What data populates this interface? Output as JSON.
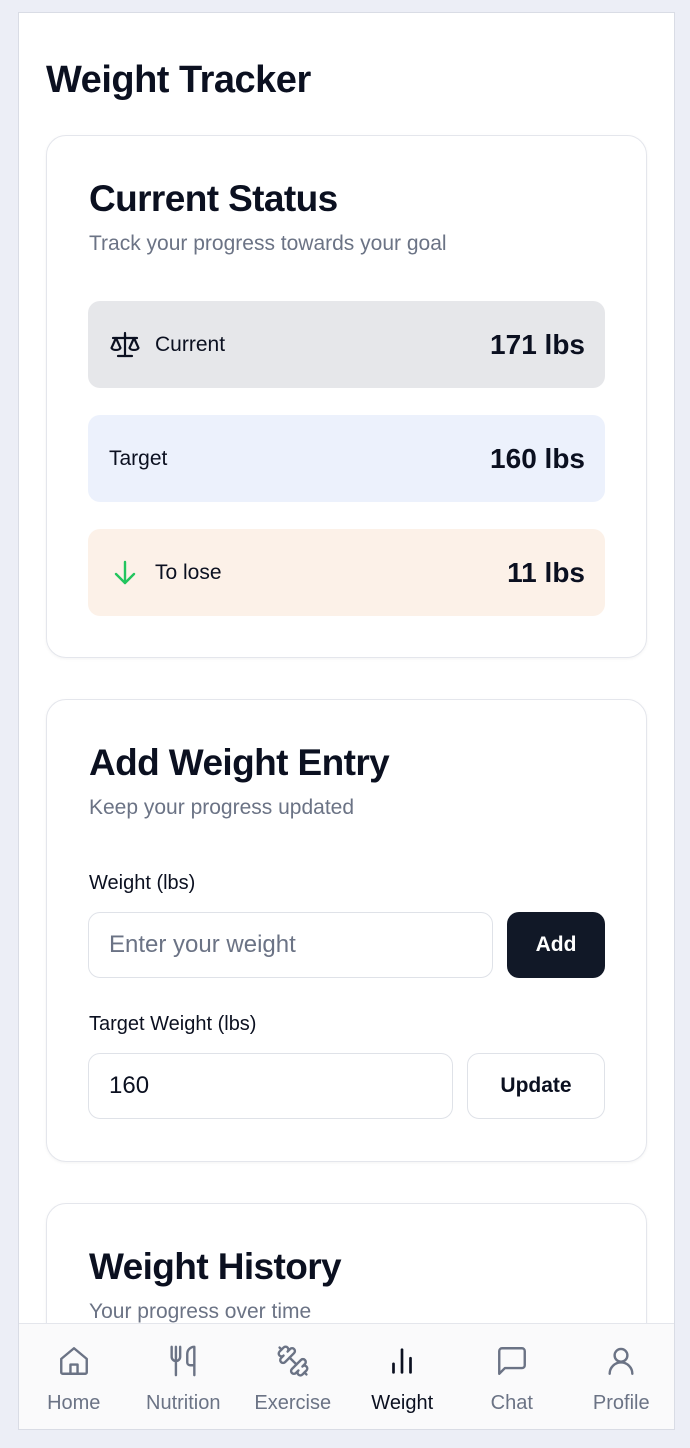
{
  "page": {
    "title": "Weight Tracker"
  },
  "status_card": {
    "title": "Current Status",
    "subtitle": "Track your progress towards your goal",
    "stats": [
      {
        "icon": "scale-icon",
        "label": "Current",
        "value": "171 lbs",
        "bg": "#e6e7ea"
      },
      {
        "icon": "",
        "label": "Target",
        "value": "160 lbs",
        "bg": "#ecf1fc"
      },
      {
        "icon": "arrow-down-icon",
        "label": "To lose",
        "value": "11 lbs",
        "bg": "#fcf1e8"
      }
    ]
  },
  "entry_card": {
    "title": "Add Weight Entry",
    "subtitle": "Keep your progress updated",
    "weight_label": "Weight (lbs)",
    "weight_placeholder": "Enter your weight",
    "weight_value": "",
    "add_label": "Add",
    "target_label": "Target Weight (lbs)",
    "target_value": "160",
    "update_label": "Update"
  },
  "history_card": {
    "title": "Weight History",
    "subtitle": "Your progress over time"
  },
  "nav": {
    "items": [
      {
        "icon": "home-icon",
        "label": "Home",
        "active": false
      },
      {
        "icon": "utensils-icon",
        "label": "Nutrition",
        "active": false
      },
      {
        "icon": "dumbbell-icon",
        "label": "Exercise",
        "active": false
      },
      {
        "icon": "bar-chart-icon",
        "label": "Weight",
        "active": true
      },
      {
        "icon": "chat-icon",
        "label": "Chat",
        "active": false
      },
      {
        "icon": "user-icon",
        "label": "Profile",
        "active": false
      }
    ]
  },
  "colors": {
    "primary_button": "#111827",
    "arrow_green": "#22c55e",
    "muted_text": "#6b7385"
  }
}
